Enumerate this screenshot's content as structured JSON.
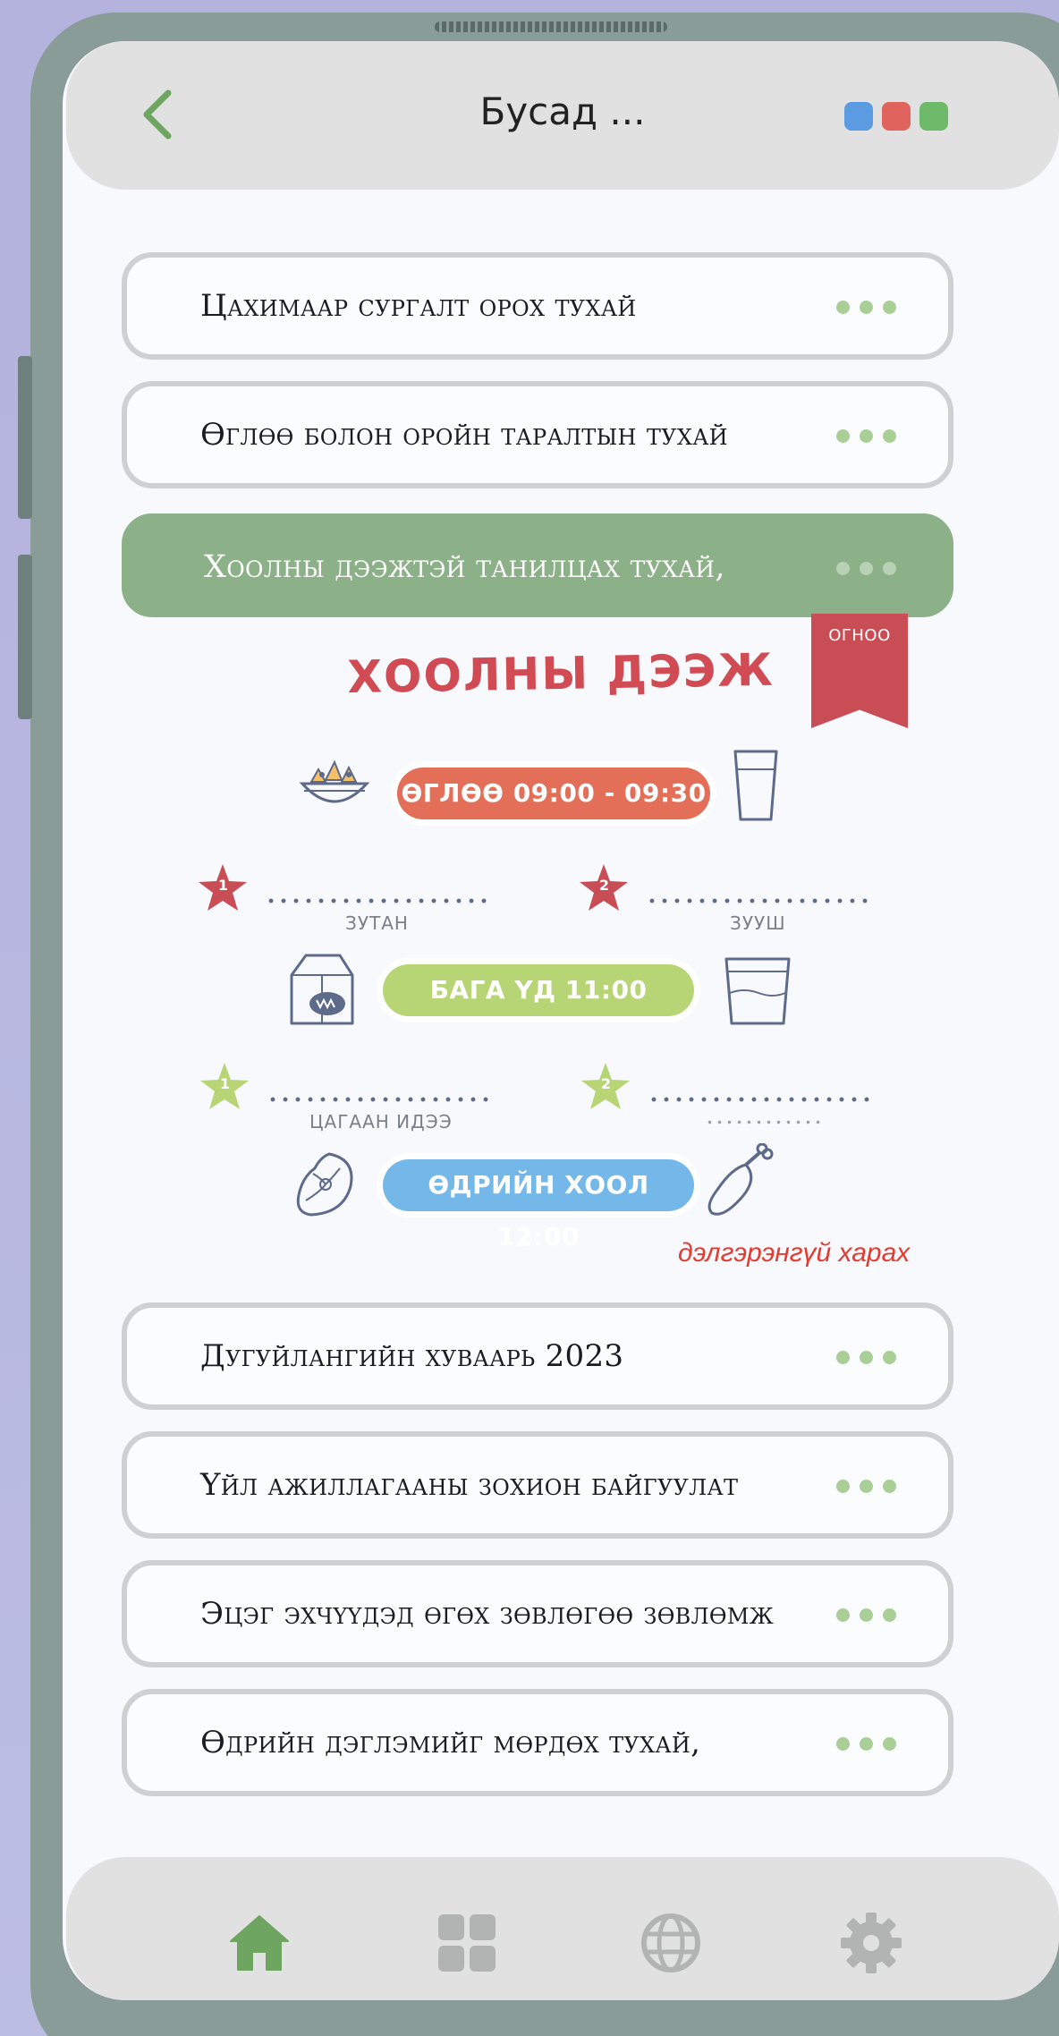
{
  "header": {
    "title": "Бусад ...",
    "back_icon": "chevron-left-icon",
    "dots_colors": [
      "#5a9be2",
      "#e0635e",
      "#6dbb6a"
    ]
  },
  "items_top": [
    {
      "label": "Цахимаар сургалт орох тухай"
    },
    {
      "label": "Өглөө болон оройн таралтын тухай"
    }
  ],
  "active_item": {
    "label": "Хоолны дээжтэй танилцах тухай,"
  },
  "menu": {
    "ribbon": "ОГНОО",
    "title": "ХООЛНЫ ДЭЭЖ",
    "breakfast": {
      "time": "ӨГЛӨӨ 09:00 - 09:30",
      "color": "#e36f59",
      "items": [
        {
          "num": "1",
          "label": "ЗУТАН"
        },
        {
          "num": "2",
          "label": "ЗУУШ"
        }
      ]
    },
    "snack": {
      "time": "БАГА ҮД 11:00",
      "color": "#b8d576",
      "items": [
        {
          "num": "1",
          "label": "ЦАГААН ИДЭЭ"
        },
        {
          "num": "2",
          "label": ""
        }
      ]
    },
    "lunch": {
      "time": "ӨДРИЙН ХООЛ 12:00",
      "color": "#74b8ea"
    },
    "more_link": "дэлгэрэнгүй харах"
  },
  "items_bottom": [
    {
      "label": "Дугуйлангийн хуваарь 2023"
    },
    {
      "label": "Үйл ажиллагааны зохион байгуулат"
    },
    {
      "label": "Эцэг эхчүүдэд өгөх зөвлөгөө зөвлөмж"
    },
    {
      "label": "Өдрийн дэглэмийг мөрдөх тухай,"
    }
  ],
  "nav": [
    "home-icon",
    "grid-icon",
    "globe-icon",
    "settings-icon"
  ],
  "colors": {
    "accent": "#6ea560",
    "active_item": "#8cb087",
    "red": "#c94d55"
  }
}
